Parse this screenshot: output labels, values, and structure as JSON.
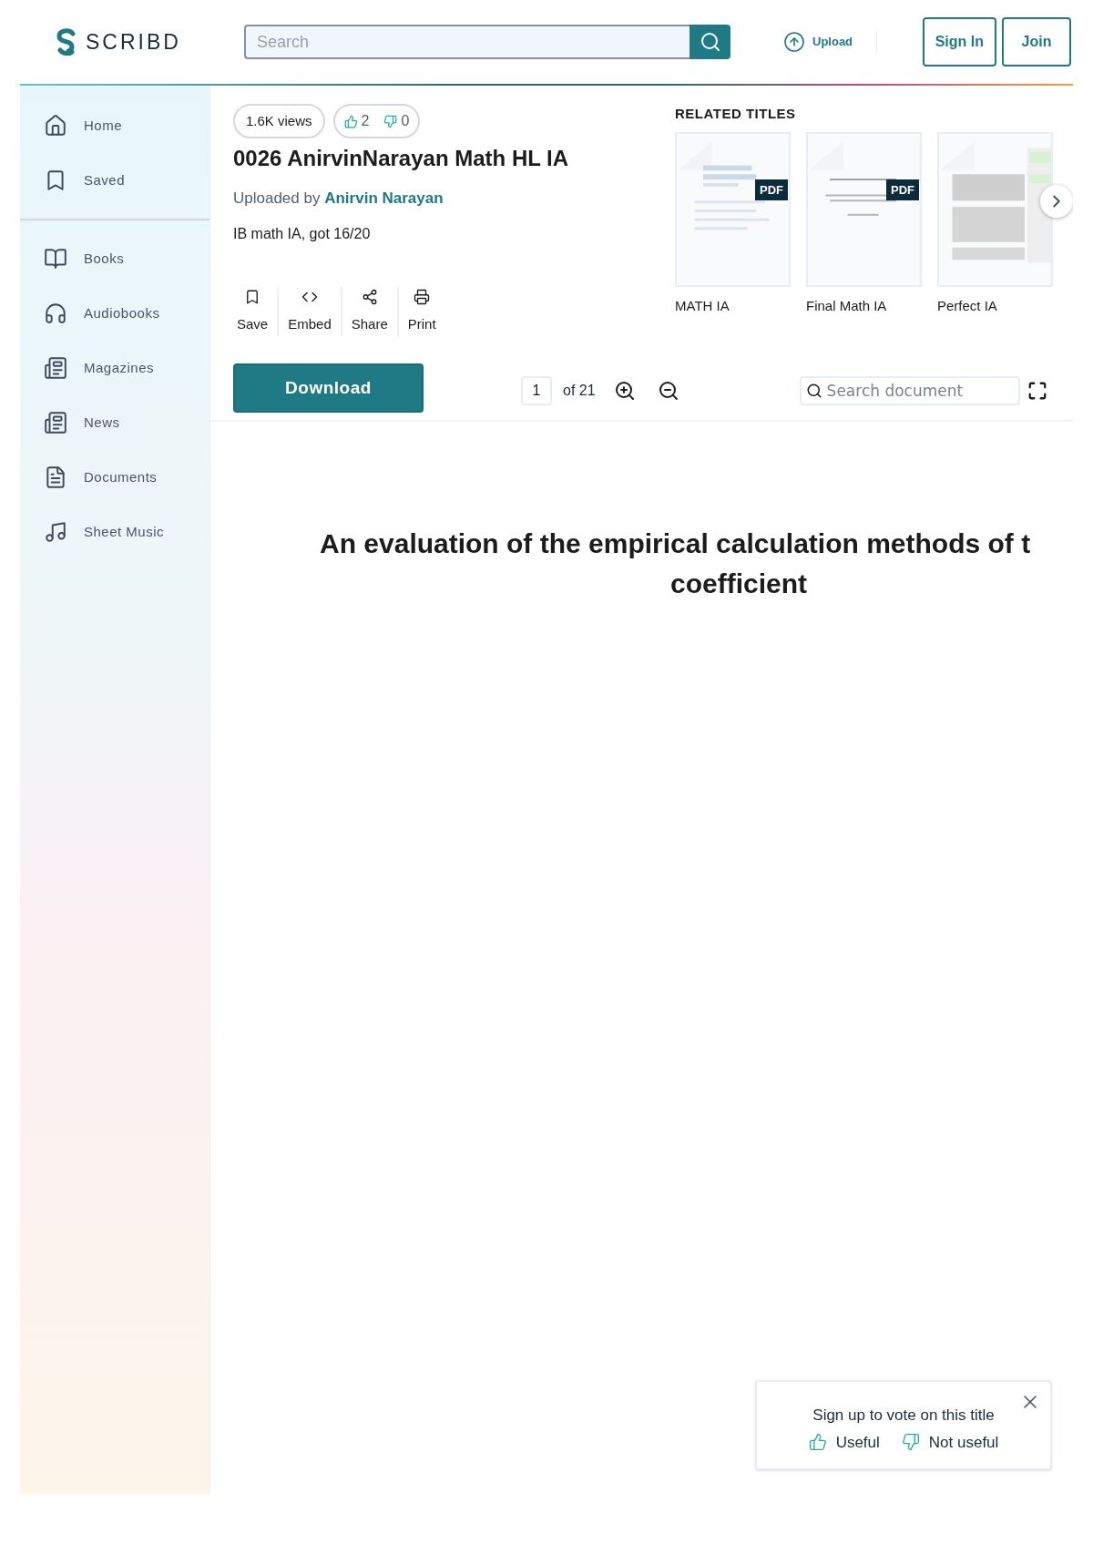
{
  "header": {
    "logo": "SCRIBD",
    "search": {
      "placeholder": "Search"
    },
    "upload": "Upload",
    "buttons": [
      "Sign In",
      "Join"
    ]
  },
  "sidebar": {
    "groups": [
      [
        {
          "label": "Home"
        },
        {
          "label": "Saved"
        }
      ],
      [
        {
          "label": "Books"
        },
        {
          "label": "Audiobooks"
        },
        {
          "label": "Magazines"
        },
        {
          "label": "News"
        },
        {
          "label": "Documents"
        },
        {
          "label": "Sheet Music"
        }
      ]
    ]
  },
  "document": {
    "views": "1.6K views",
    "upvotes": "2",
    "downvotes": "0",
    "title": "0026 AnirvinNarayan Math HL IA",
    "uploaded_by_label": "Uploaded by",
    "uploader": "Anirvin Narayan",
    "description": "IB math IA, got 16/20",
    "actions": [
      {
        "label": "Save"
      },
      {
        "label": "Embed"
      },
      {
        "label": "Share"
      },
      {
        "label": "Print"
      }
    ],
    "download": "Download"
  },
  "related": {
    "heading": "RELATED TITLES",
    "items": [
      {
        "title": "MATH IA",
        "badge": "PDF"
      },
      {
        "title": "Final Math IA",
        "badge": "PDF"
      },
      {
        "title": "Perfect IA"
      }
    ]
  },
  "viewer": {
    "page": "1",
    "of": "of 21",
    "search": {
      "placeholder": "Search document"
    },
    "heading_lines": [
      "An evaluation of the empirical calculation methods of t",
      "coefficient"
    ]
  },
  "vote_popup": {
    "text": "Sign up to vote on this title",
    "options": [
      "Useful",
      "Not useful"
    ]
  }
}
